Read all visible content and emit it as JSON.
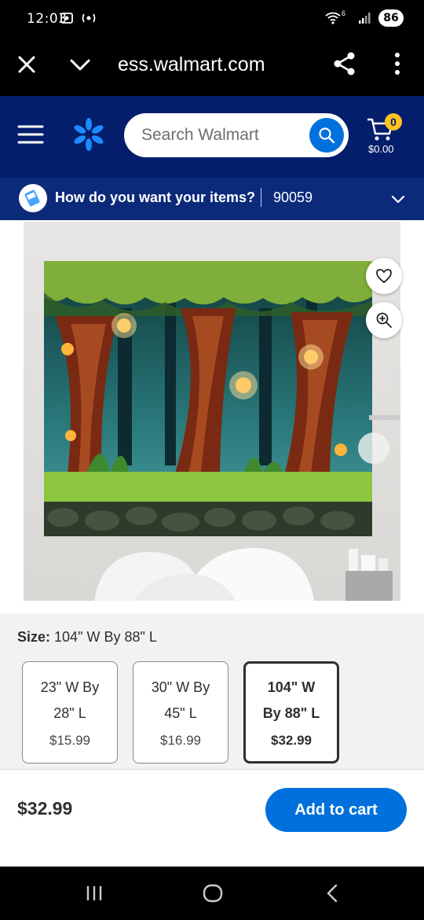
{
  "status_bar": {
    "time": "12:03",
    "signal_label": "6",
    "battery": "86"
  },
  "browser": {
    "url": "ess.walmart.com"
  },
  "header": {
    "search_placeholder": "Search Walmart",
    "cart_count": "0",
    "cart_total": "$0.00"
  },
  "delivery": {
    "question": "How do you want your items?",
    "zip": "90059"
  },
  "product": {
    "size_label": "Size:",
    "size_value": "104\" W By 88\" L",
    "options": [
      {
        "name": "23\" W By 28\" L",
        "price": "$15.99",
        "selected": false
      },
      {
        "name": "30\" W By 45\" L",
        "price": "$16.99",
        "selected": false
      },
      {
        "name": "104\" W By 88\" L",
        "price": "$32.99",
        "selected": true
      }
    ]
  },
  "purchase": {
    "price": "$32.99",
    "add_to_cart_label": "Add to cart"
  },
  "colors": {
    "walmart_blue": "#0071dc",
    "header_navy": "#041e6b",
    "spark_yellow": "#ffc220"
  },
  "icons": [
    "close-icon",
    "chevron-down-icon",
    "share-icon",
    "more-icon",
    "menu-icon",
    "spark-logo-icon",
    "search-icon",
    "cart-icon",
    "delivery-icon",
    "heart-icon",
    "zoom-icon",
    "recents-icon",
    "home-icon",
    "back-icon"
  ]
}
